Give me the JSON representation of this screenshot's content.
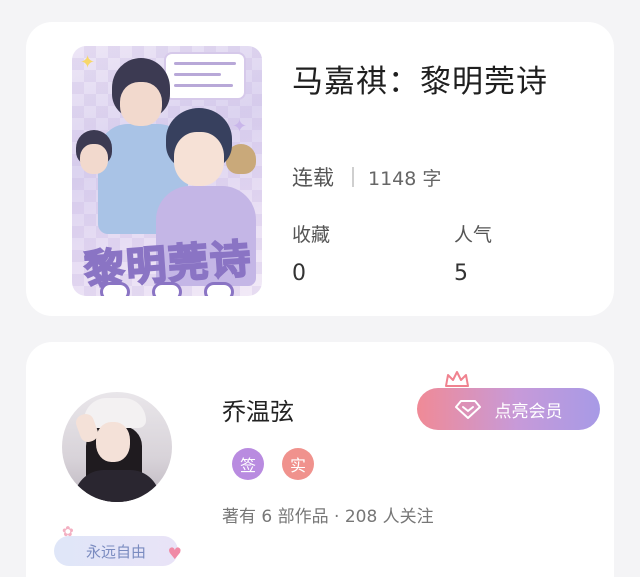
{
  "book": {
    "title": "马嘉祺：黎明莞诗",
    "cover_title_art": "黎明莞诗",
    "status": "连载",
    "word_count": "1148 字",
    "favorites_label": "收藏",
    "favorites_value": "0",
    "popularity_label": "人气",
    "popularity_value": "5"
  },
  "author": {
    "name": "乔温弦",
    "badge_signed": "签",
    "badge_verified": "实",
    "meta": "著有 6 部作品 · 208 人关注",
    "tag": "永远自由",
    "vip_button_label": "点亮会员"
  },
  "colors": {
    "vip_gradient_start": "#f08a96",
    "vip_gradient_end": "#a79ae6",
    "badge_signed": "#b98be0",
    "badge_verified": "#f0928d",
    "crown": "#f0828f"
  }
}
